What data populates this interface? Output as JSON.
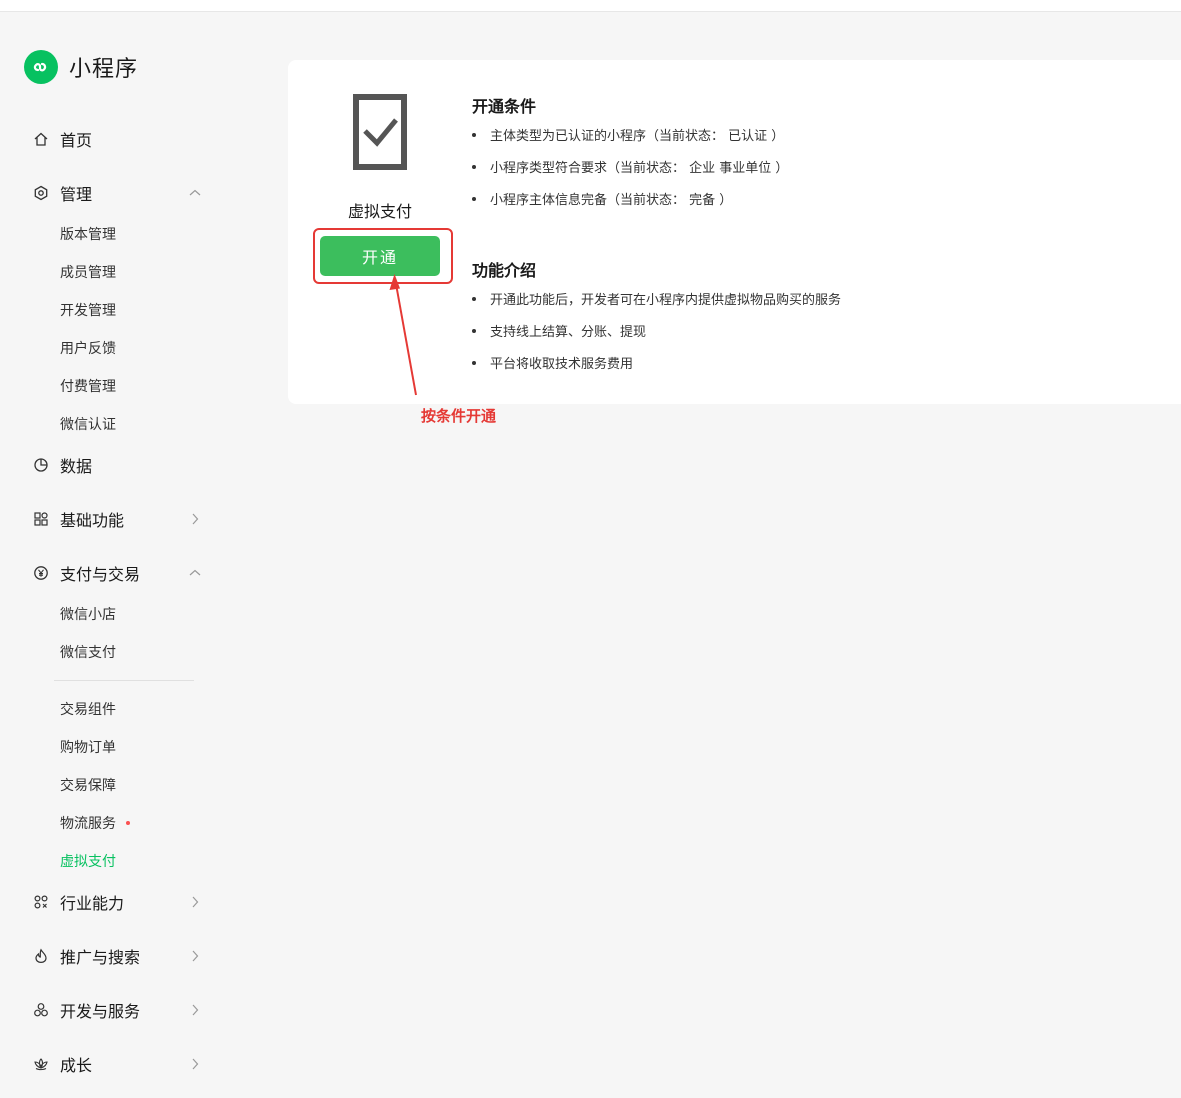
{
  "app": {
    "name": "小程序"
  },
  "sidebar": {
    "home": "首页",
    "manage": {
      "label": "管理",
      "items": [
        "版本管理",
        "成员管理",
        "开发管理",
        "用户反馈",
        "付费管理",
        "微信认证"
      ]
    },
    "data": "数据",
    "basic": "基础功能",
    "pay": {
      "label": "支付与交易",
      "items_a": [
        "微信小店",
        "微信支付"
      ],
      "items_b": [
        "交易组件",
        "购物订单",
        "交易保障",
        "物流服务",
        "虚拟支付"
      ]
    },
    "industry": "行业能力",
    "promote": "推广与搜索",
    "devservice": "开发与服务",
    "growth": "成长"
  },
  "feature": {
    "name": "虚拟支付",
    "open_button": "开通"
  },
  "conditions": {
    "title": "开通条件",
    "items": [
      "主体类型为已认证的小程序（当前状态：  已认证 ）",
      "小程序类型符合要求（当前状态：  企业 事业单位 ）",
      "小程序主体信息完备（当前状态：  完备 ）"
    ]
  },
  "intro": {
    "title": "功能介绍",
    "items": [
      "开通此功能后，开发者可在小程序内提供虚拟物品购买的服务",
      "支持线上结算、分账、提现",
      "平台将收取技术服务费用"
    ]
  },
  "annotation": {
    "text": "按条件开通"
  },
  "colors": {
    "brand_green": "#07c160",
    "button_green": "#3cbe5d",
    "annotation_red": "#e53935",
    "notify_dot": "#fa5151"
  }
}
